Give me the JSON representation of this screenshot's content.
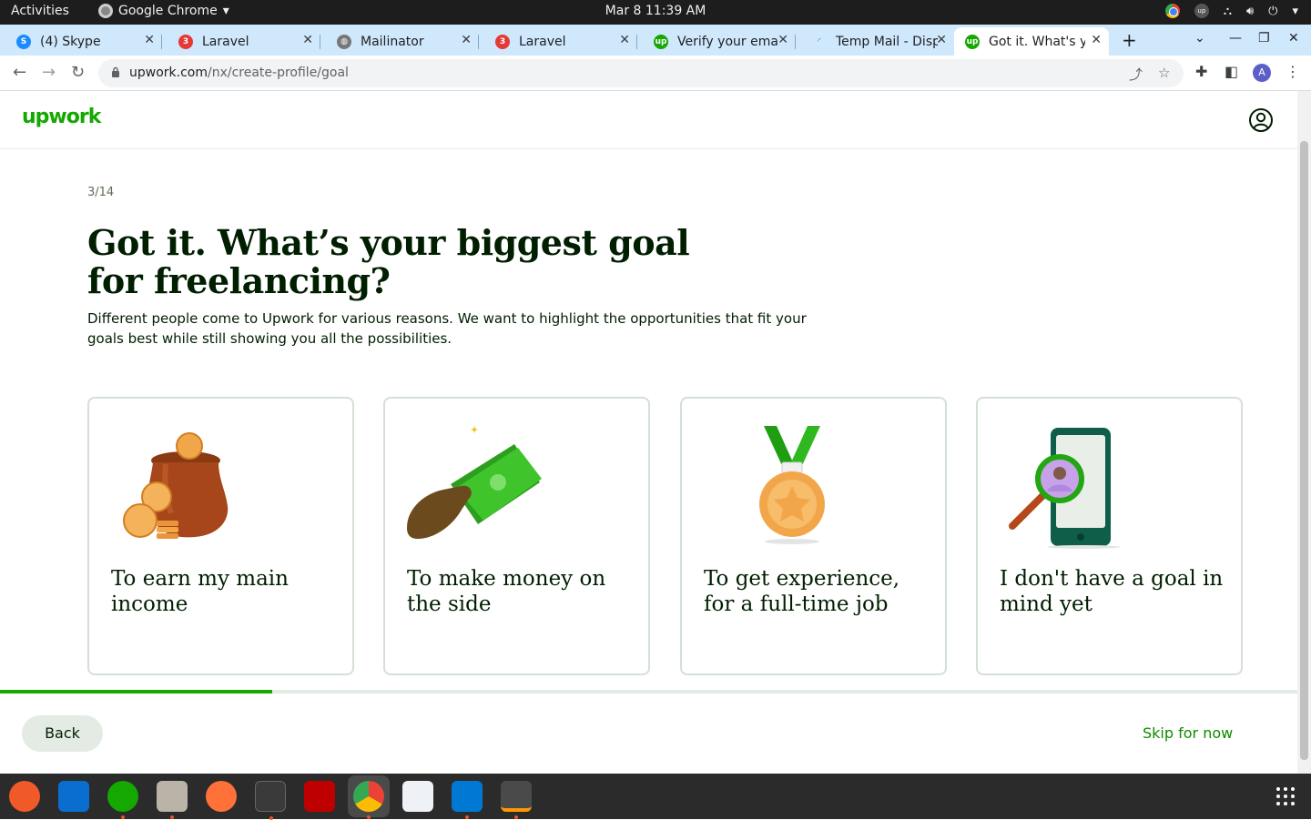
{
  "system_bar": {
    "activities": "Activities",
    "app_name": "Google Chrome",
    "clock": "Mar 8  11:39 AM"
  },
  "tabs": [
    {
      "title": "(4) Skype",
      "icon": "skype-icon"
    },
    {
      "title": "Laravel",
      "icon": "laravel-icon"
    },
    {
      "title": "Mailinator",
      "icon": "globe-icon"
    },
    {
      "title": "Laravel",
      "icon": "laravel-icon"
    },
    {
      "title": "Verify your emai",
      "icon": "upwork-icon"
    },
    {
      "title": "Temp Mail - Disp",
      "icon": "loading-icon"
    },
    {
      "title": "Got it. What's yo",
      "icon": "upwork-icon"
    }
  ],
  "address_bar": {
    "domain": "upwork.com",
    "path": "/nx/create-profile/goal"
  },
  "profile_initial": "A",
  "upwork": {
    "logo": "upwork",
    "step": "3/14",
    "title": "Got it. What’s your biggest goal for freelancing?",
    "subtitle": "Different people come to Upwork for various reasons. We want to highlight the opportunities that fit your goals best while still showing you all the possibilities.",
    "options": [
      {
        "label": "To earn my main income",
        "illustration": "money-bag-icon"
      },
      {
        "label": "To make money on the side",
        "illustration": "cash-in-hand-icon"
      },
      {
        "label": "To get experience, for a full-time job",
        "illustration": "medal-icon"
      },
      {
        "label": "I don't have a goal in mind yet",
        "illustration": "phone-magnifier-icon"
      }
    ],
    "progress_fraction": 0.21,
    "back_label": "Back",
    "skip_label": "Skip for now"
  },
  "colors": {
    "brand_green": "#14a800",
    "link_green": "#108a00",
    "text_dark": "#001e00",
    "tab_strip": "#cfe8fc"
  }
}
